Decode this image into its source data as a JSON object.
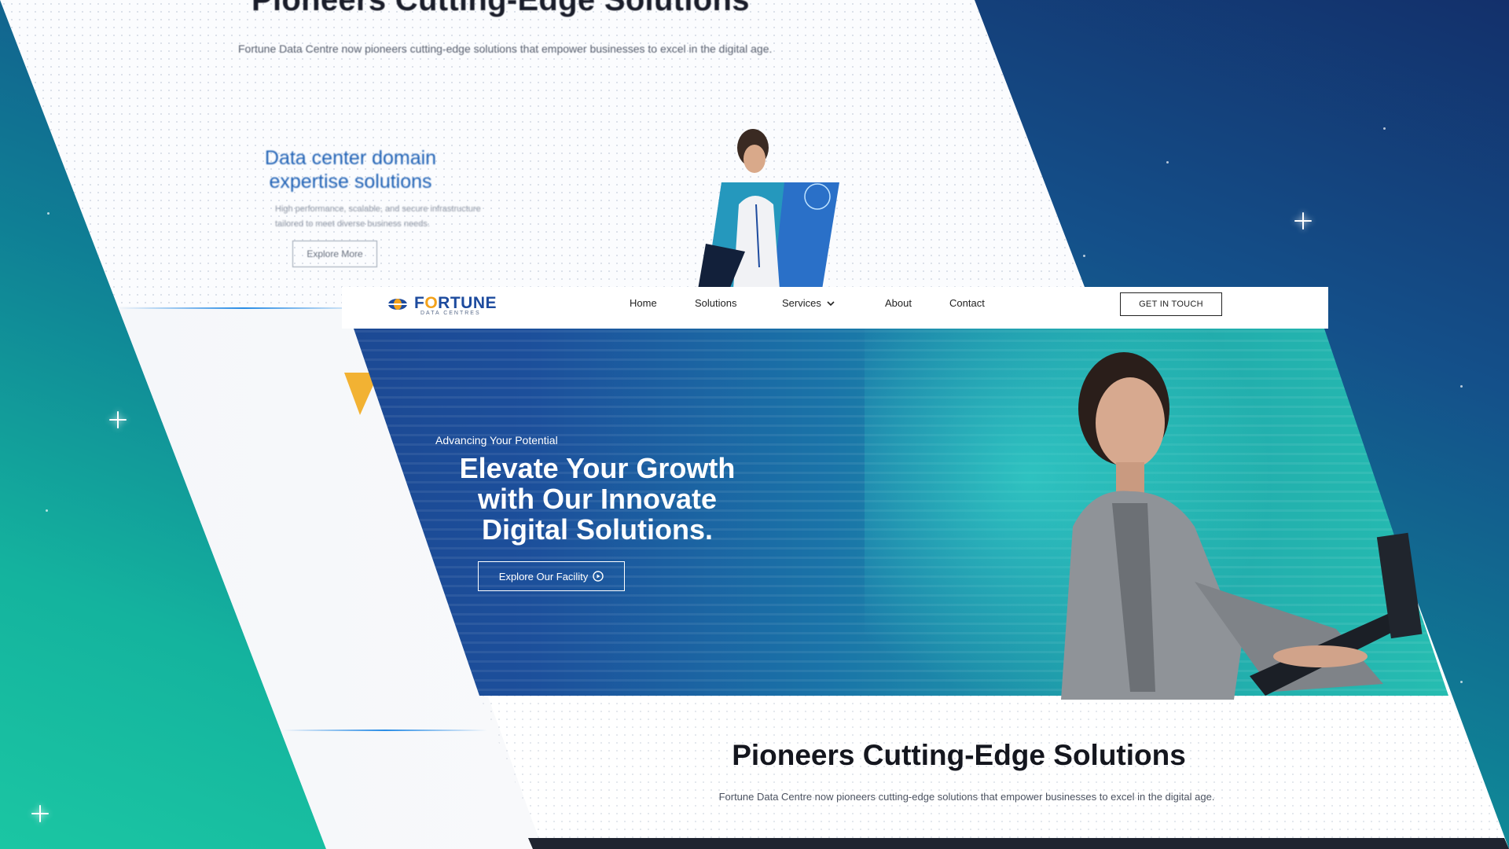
{
  "back_page": {
    "title": "Pioneers Cutting-Edge Solutions",
    "subtitle": "Fortune Data Centre now pioneers cutting-edge solutions that empower businesses to excel in the digital age.",
    "feature_heading_line1": "Data center domain",
    "feature_heading_line2": "expertise solutions",
    "feature_text": "High performance, scalable, and secure infrastructure tailored to meet diverse business needs.",
    "feature_button": "Explore More"
  },
  "front_page": {
    "logo": {
      "word_pre": "F",
      "word_o": "O",
      "word_post": "RTUNE",
      "tagline": "DATA CENTRES"
    },
    "nav": {
      "items": [
        "Home",
        "Solutions",
        "Services",
        "About",
        "Contact"
      ],
      "cta": "GET IN TOUCH"
    },
    "hero": {
      "kicker": "Advancing Your Potential",
      "title_line1": "Elevate Your Growth",
      "title_line2": "with Our Innovate",
      "title_line3": "Digital Solutions.",
      "button": "Explore Our Facility"
    },
    "section": {
      "title": "Pioneers Cutting-Edge Solutions",
      "subtitle": "Fortune Data Centre now pioneers cutting-edge solutions that empower businesses to excel in the digital age."
    }
  },
  "colors": {
    "brand_blue": "#1d4b9e",
    "brand_orange": "#f3a21b",
    "bg_gradient_top": "#13306b",
    "bg_gradient_bottom": "#1bc6a3"
  }
}
